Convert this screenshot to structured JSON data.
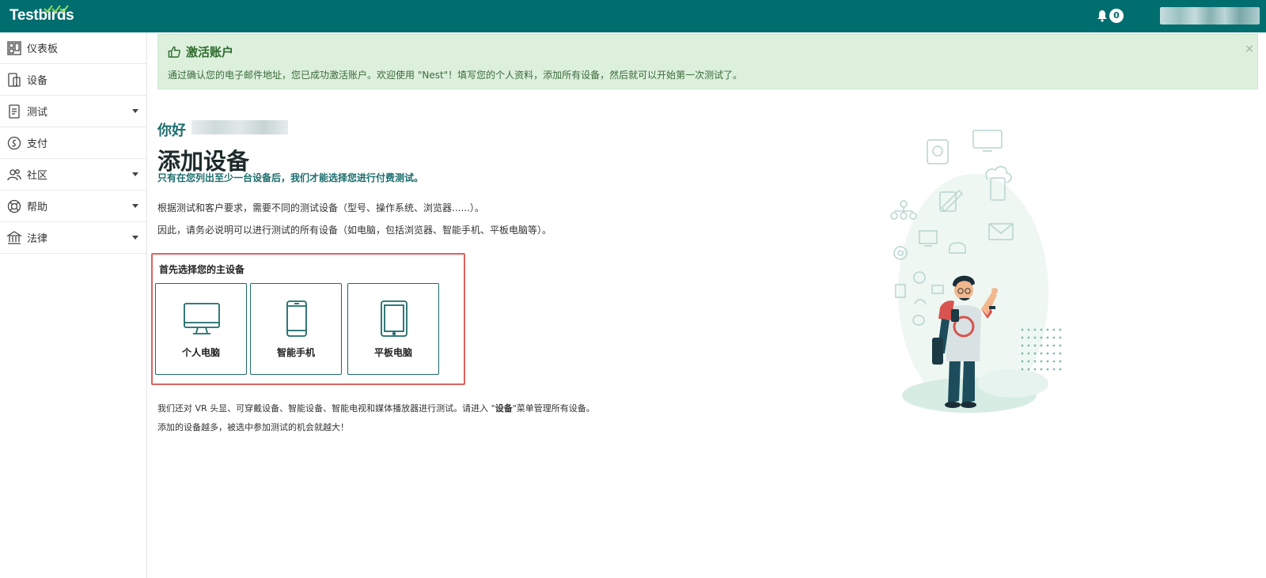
{
  "app": {
    "logo": "Testbirds",
    "notification_count": "0"
  },
  "sidebar": {
    "items": [
      {
        "label": "仪表板",
        "icon": "dashboard-icon",
        "has_submenu": false
      },
      {
        "label": "设备",
        "icon": "devices-icon",
        "has_submenu": false
      },
      {
        "label": "测试",
        "icon": "tests-icon",
        "has_submenu": true
      },
      {
        "label": "支付",
        "icon": "payment-icon",
        "has_submenu": false
      },
      {
        "label": "社区",
        "icon": "community-icon",
        "has_submenu": true
      },
      {
        "label": "帮助",
        "icon": "help-icon",
        "has_submenu": true
      },
      {
        "label": "法律",
        "icon": "legal-icon",
        "has_submenu": true
      }
    ]
  },
  "alert": {
    "title": "激活账户",
    "text": "通过确认您的电子邮件地址，您已成功激活账户。欢迎使用 \"Nest\"！填写您的个人资料，添加所有设备，然后就可以开始第一次测试了。",
    "close": "×"
  },
  "main": {
    "greeting": "你好",
    "title": "添加设备",
    "subtitle": "只有在您列出至少一台设备后，我们才能选择您进行付费测试。",
    "para1": "根据测试和客户要求，需要不同的测试设备（型号、操作系统、浏览器......）。",
    "para2": "因此，请务必说明可以进行测试的所有设备（如电脑，包括浏览器、智能手机、平板电脑等）。",
    "select_label": "首先选择您的主设备",
    "devices": [
      {
        "label": "个人电脑",
        "icon": "desktop-icon"
      },
      {
        "label": "智能手机",
        "icon": "smartphone-icon"
      },
      {
        "label": "平板电脑",
        "icon": "tablet-icon"
      }
    ],
    "para3_before": "我们还对 VR 头显、可穿戴设备、智能设备、智能电视和媒体播放器进行测试。请进入 \"",
    "para3_bold": "设备",
    "para3_after": "\"菜单管理所有设备。",
    "para4": "添加的设备越多，被选中参加测试的机会就越大！"
  },
  "colors": {
    "brand": "#006d6e",
    "alert_bg": "#dcf0dc",
    "highlight": "#e06060"
  }
}
